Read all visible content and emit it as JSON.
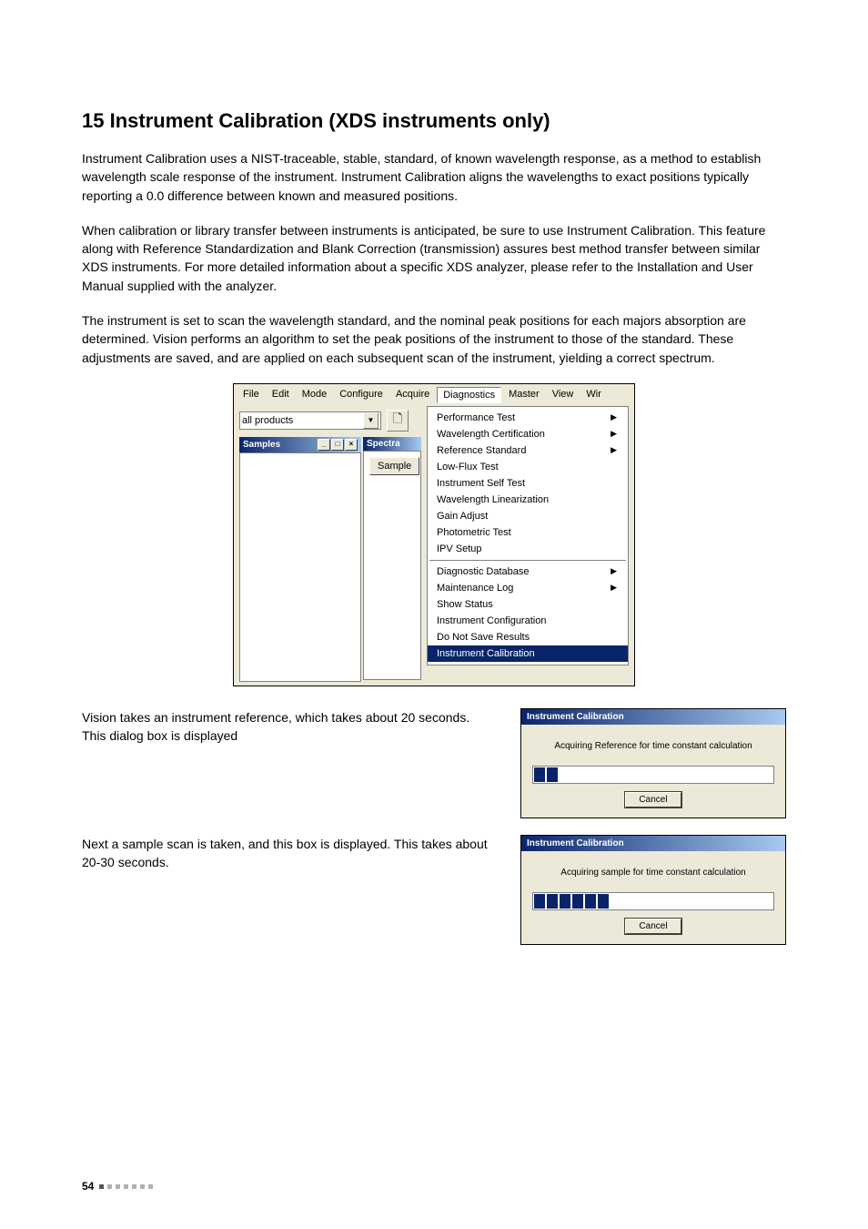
{
  "heading": "15 Instrument Calibration (XDS instruments only)",
  "para1": "Instrument Calibration uses a NIST-traceable, stable, standard, of known wavelength response, as a method to establish wavelength scale response of the instrument. Instrument Calibration aligns the wavelengths to exact positions typically reporting a 0.0 difference between known and measured positions.",
  "para2": "When calibration or library transfer between instruments is anticipated, be sure to use Instrument Calibration. This feature along with Reference Standardization and Blank Correction (transmission) assures best method transfer between similar XDS instruments. For more detailed information about a specific XDS analyzer, please refer to the Installation and User Manual supplied with the analyzer.",
  "para3": "The instrument is set to scan the wavelength standard, and the nominal peak positions for each majors absorption are determined. Vision performs an algorithm to set the peak positions of the instrument to those of the standard. These adjustments are saved, and are applied on each subsequent scan of the instrument, yielding a correct spectrum.",
  "menubar": {
    "items": [
      "File",
      "Edit",
      "Mode",
      "Configure",
      "Acquire",
      "Diagnostics",
      "Master",
      "View",
      "Wir"
    ],
    "combo_value": "all products",
    "samples_title": "Samples",
    "spectra_title": "Spectra",
    "sample_btn": "Sample"
  },
  "dropdown": {
    "group1": [
      {
        "label": "Performance Test",
        "sub": true
      },
      {
        "label": "Wavelength Certification",
        "sub": true
      },
      {
        "label": "Reference Standard",
        "sub": true
      },
      {
        "label": "Low-Flux Test",
        "sub": false
      },
      {
        "label": "Instrument Self Test",
        "sub": false
      },
      {
        "label": "Wavelength Linearization",
        "sub": false
      },
      {
        "label": "Gain Adjust",
        "sub": false
      },
      {
        "label": "Photometric Test",
        "sub": false
      },
      {
        "label": "IPV Setup",
        "sub": false
      }
    ],
    "group2": [
      {
        "label": "Diagnostic Database",
        "sub": true
      },
      {
        "label": "Maintenance Log",
        "sub": true
      },
      {
        "label": "Show Status",
        "sub": false
      },
      {
        "label": "Instrument Configuration",
        "sub": false
      },
      {
        "label": "Do Not Save Results",
        "sub": false
      },
      {
        "label": "Instrument Calibration",
        "sub": false,
        "hl": true
      }
    ]
  },
  "row1_text": "Vision takes an instrument reference, which takes about 20 seconds. This dialog box is displayed",
  "row2_text": "Next a sample scan is taken, and this box is displayed. This takes about 20-30 seconds.",
  "dlg": {
    "title": "Instrument Calibration",
    "msg1": "Acquiring Reference for time constant calculation",
    "msg2": "Acquiring sample for time constant calculation",
    "cancel": "Cancel"
  },
  "page_number": "54"
}
